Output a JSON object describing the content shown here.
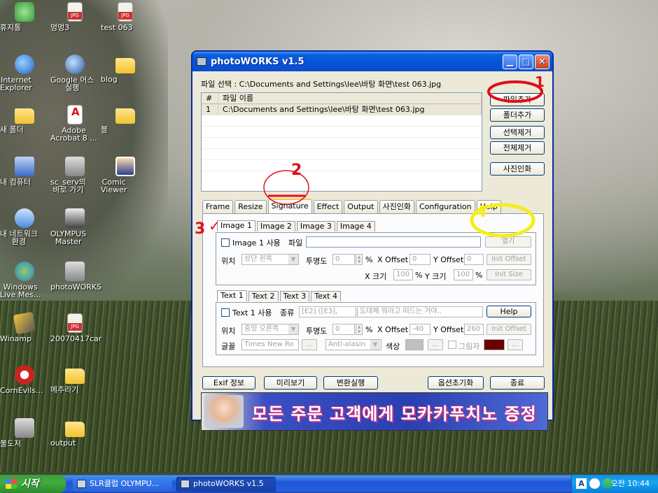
{
  "desktop": {
    "icons": [
      {
        "label": "휴지통",
        "icon": "recycle-bin-icon"
      },
      {
        "label": "멍멍3",
        "icon": "jpg-file-icon"
      },
      {
        "label": "test 063",
        "icon": "jpg-file-icon"
      },
      {
        "label": "Internet\nExplorer",
        "icon": "internet-explorer-icon"
      },
      {
        "label": "Google 어스\n실행",
        "icon": "google-earth-icon"
      },
      {
        "label": "blog",
        "icon": "folder-icon"
      },
      {
        "label": "새 폴더",
        "icon": "folder-icon"
      },
      {
        "label": "Adobe\nAcrobat 8 ...",
        "icon": "adobe-acrobat-icon"
      },
      {
        "label": "블",
        "icon": "folder-icon"
      },
      {
        "label": "내 컴퓨터",
        "icon": "my-computer-icon"
      },
      {
        "label": "sc_serv의\n바로 가기",
        "icon": "shortcut-icon"
      },
      {
        "label": "Comic\nViewer",
        "icon": "comic-viewer-icon"
      },
      {
        "label": "내 네트워크\n환경",
        "icon": "network-icon"
      },
      {
        "label": "OLYMPUS\nMaster",
        "icon": "olympus-master-icon"
      },
      {
        "label": "Windows\nLive Mes...",
        "icon": "messenger-icon"
      },
      {
        "label": "photoWORKS",
        "icon": "photoworks-icon"
      },
      {
        "label": "Winamp",
        "icon": "winamp-icon"
      },
      {
        "label": "20070417car",
        "icon": "document-icon"
      },
      {
        "label": "CornEvils...",
        "icon": "corn-evils-icon"
      },
      {
        "label": "메추라기",
        "icon": "folder-icon"
      },
      {
        "label": "불도저",
        "icon": "bulldozer-icon"
      },
      {
        "label": "output",
        "icon": "folder-icon"
      }
    ]
  },
  "window": {
    "title": "photoWORKS v1.5",
    "file_select_label": "파일 선택 : C:\\Documents and Settings\\lee\\바탕 화면\\test 063.jpg",
    "file_list": {
      "headers": [
        "#",
        "파일 이름"
      ],
      "rows": [
        [
          "1",
          "C:\\Documents and Settings\\lee\\바탕 화면\\test 063.jpg"
        ]
      ]
    },
    "side_buttons": {
      "add_file": "파일추가",
      "add_folder": "폴더추가",
      "remove_selected": "선택제거",
      "remove_all": "전체제거",
      "photo_print": "사진인화"
    },
    "tabs": [
      "Frame",
      "Resize",
      "Signature",
      "Effect",
      "Output",
      "사진인화",
      "Configuration",
      "Help"
    ],
    "active_tab": "Signature",
    "image_section": {
      "tabs": [
        "Image 1",
        "Image 2",
        "Image 3",
        "Image 4"
      ],
      "use_label": "Image 1 사용",
      "file_label": "파일",
      "file_value": "",
      "open_button": "열기",
      "position_label": "위치",
      "position_value": "상단 왼쪽",
      "opacity_label": "투명도",
      "opacity_value": "0",
      "percent": "%",
      "x_offset_label": "X Offset",
      "x_offset_value": "0",
      "y_offset_label": "Y Offset",
      "y_offset_value": "0",
      "init_offset_button": "Init Offset",
      "x_size_label": "X 크기",
      "x_size_value": "100",
      "y_size_label": "Y 크기",
      "y_size_value": "100",
      "init_size_button": "Init Size"
    },
    "text_section": {
      "tabs": [
        "Text 1",
        "Text 2",
        "Text 3",
        "Text 4"
      ],
      "use_label": "Text 1 사용",
      "type_label": "종류",
      "type_value": "[E2] ([E3],",
      "text_value": "도대체 뭐라고 떠드는 거야..",
      "help_button": "Help",
      "position_label": "위치",
      "position_value": "중앙 오른쪽",
      "opacity_label": "투명도",
      "opacity_value": "0",
      "percent": "%",
      "x_offset_label": "X Offset",
      "x_offset_value": "-40",
      "y_offset_label": "Y Offset",
      "y_offset_value": "260",
      "init_offset_button": "Init Offset",
      "font_label": "글꼴",
      "font_value": "Times New Ro",
      "browse": "...",
      "antialias_value": "Anti-alasin",
      "color_label": "색상",
      "shadow_label": "그림자",
      "color_swatch": "#c0c0c0",
      "shadow_swatch": "#6b0000"
    },
    "bottom_buttons": {
      "exif": "Exif 정보",
      "preview": "미리보기",
      "convert": "변환실행",
      "reset_options": "옵션초기화",
      "exit": "종료"
    },
    "banner_text": "모든 주문 고객에게 모카카푸치노 증정"
  },
  "annotations": {
    "marks": [
      "1",
      "2",
      "3",
      "4"
    ],
    "check": "✓",
    "colors": {
      "red": "#e0101a",
      "yellow": "#f3ee1a"
    }
  },
  "taskbar": {
    "start_label": "시작",
    "tasks": [
      "SLR클럽 OLYMPU...",
      "photoWORKS v1.5"
    ],
    "clock": "오전 10:44",
    "ime": "A"
  }
}
